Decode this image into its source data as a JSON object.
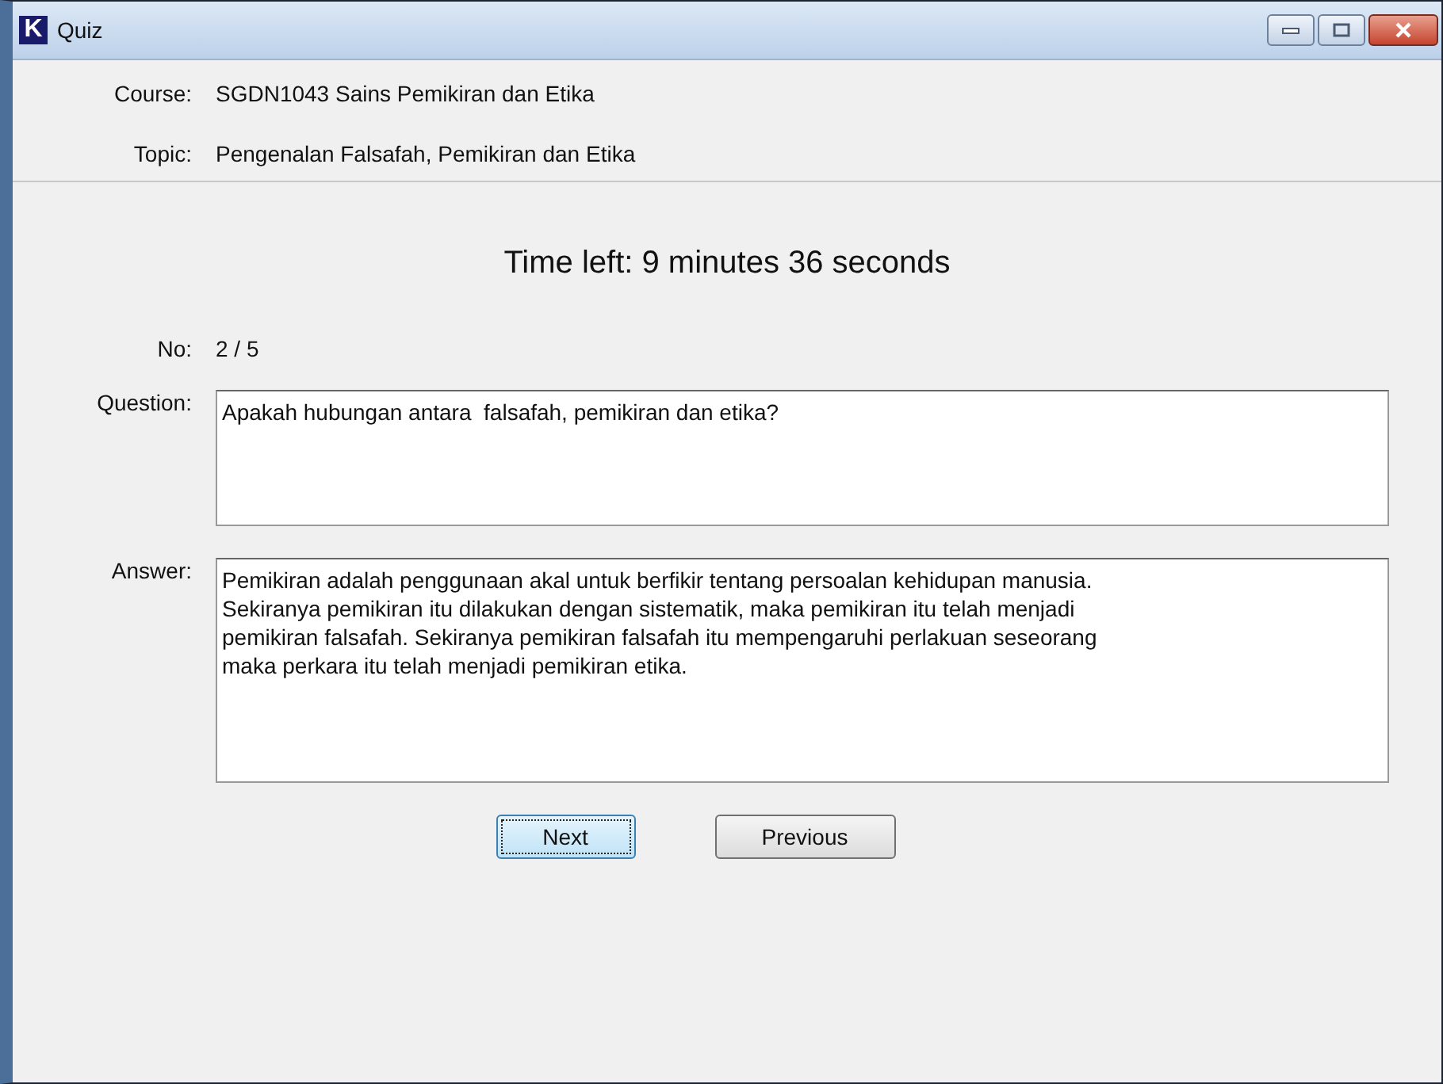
{
  "window": {
    "icon_letter": "K",
    "title": "Quiz"
  },
  "header": [
    {
      "label": "Course:",
      "value": "SGDN1043 Sains Pemikiran dan Etika"
    },
    {
      "label": "Topic:",
      "value": "Pengenalan Falsafah, Pemikiran dan Etika"
    }
  ],
  "timer": "Time left: 9 minutes 36 seconds",
  "number": {
    "label": "No:",
    "value": "2 / 5"
  },
  "question": {
    "label": "Question:",
    "value": "Apakah hubungan antara  falsafah, pemikiran dan etika?"
  },
  "answer": {
    "label": "Answer:",
    "value": "Pemikiran adalah penggunaan akal untuk berfikir tentang persoalan kehidupan manusia.\nSekiranya pemikiran itu dilakukan dengan sistematik, maka pemikiran itu telah menjadi\npemikiran falsafah. Sekiranya pemikiran falsafah itu mempengaruhi perlakuan seseorang\nmaka perkara itu telah menjadi pemikiran etika."
  },
  "buttons": [
    {
      "label": "Next",
      "focused": true
    },
    {
      "label": "Previous",
      "focused": false
    }
  ]
}
